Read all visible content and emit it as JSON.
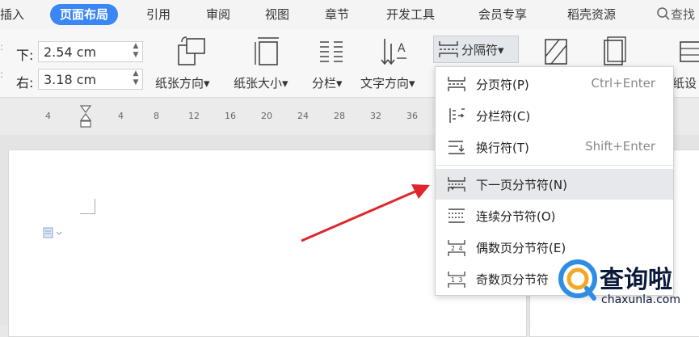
{
  "tabs": [
    "插入",
    "页面布局",
    "引用",
    "审阅",
    "视图",
    "章节",
    "开发工具",
    "会员专享",
    "稻壳资源"
  ],
  "active_tab_index": 1,
  "search_label": "查找",
  "margins": {
    "bottom_label": "下:",
    "bottom_value": "2.54 cm",
    "right_label": "右:",
    "right_value": "3.18 cm"
  },
  "tools": {
    "orientation": "纸张方向",
    "size": "纸张大小",
    "columns": "分栏",
    "text_direction": "文字方向",
    "separator": "分隔符",
    "cut_label": "纸设"
  },
  "ruler_ticks": [
    "4",
    "4",
    "8",
    "12",
    "16",
    "20",
    "24",
    "28",
    "32",
    "36"
  ],
  "menu": {
    "items": [
      {
        "label": "分页符(P)",
        "shortcut": "Ctrl+Enter",
        "icon": "page-break-icon"
      },
      {
        "label": "分栏符(C)",
        "shortcut": "",
        "icon": "column-break-icon"
      },
      {
        "label": "换行符(T)",
        "shortcut": "Shift+Enter",
        "icon": "line-break-icon"
      },
      {
        "label": "下一页分节符(N)",
        "shortcut": "",
        "icon": "next-page-section-icon"
      },
      {
        "label": "连续分节符(O)",
        "shortcut": "",
        "icon": "continuous-section-icon"
      },
      {
        "label": "偶数页分节符(E)",
        "shortcut": "",
        "icon": "even-page-section-icon"
      },
      {
        "label": "奇数页分节符",
        "shortcut": "",
        "icon": "odd-page-section-icon"
      }
    ],
    "highlighted_index": 3
  },
  "watermark": {
    "title": "查询啦",
    "subtitle": "chaxunla.com"
  },
  "colors": {
    "accent": "#3b86f5",
    "arrow": "#e0262b"
  }
}
